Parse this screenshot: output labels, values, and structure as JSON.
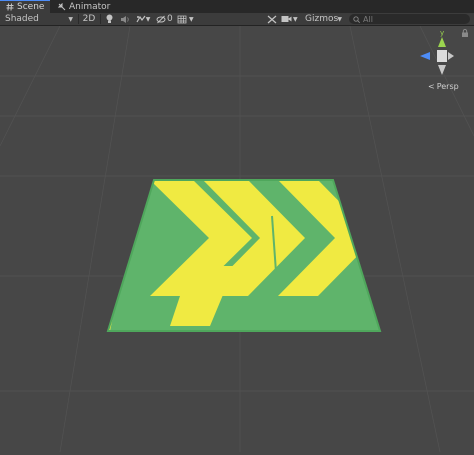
{
  "tabs": [
    {
      "label": "Scene",
      "icon": "hashtag-icon",
      "active": true
    },
    {
      "label": "Animator",
      "icon": "animator-icon",
      "active": false
    }
  ],
  "toolbar": {
    "shading_mode": "Shaded",
    "mode_2d_label": "2D",
    "hidden_objects_count": "0",
    "gizmos_label": "Gizmos",
    "search_placeholder": "All"
  },
  "gizmo": {
    "y_label": "y",
    "projection_label": "Persp"
  },
  "colors": {
    "tile_green": "#5fb46b",
    "tile_yellow": "#f0ea42",
    "viewport_bg": "#474747",
    "accent_blue": "#4e8df7"
  }
}
